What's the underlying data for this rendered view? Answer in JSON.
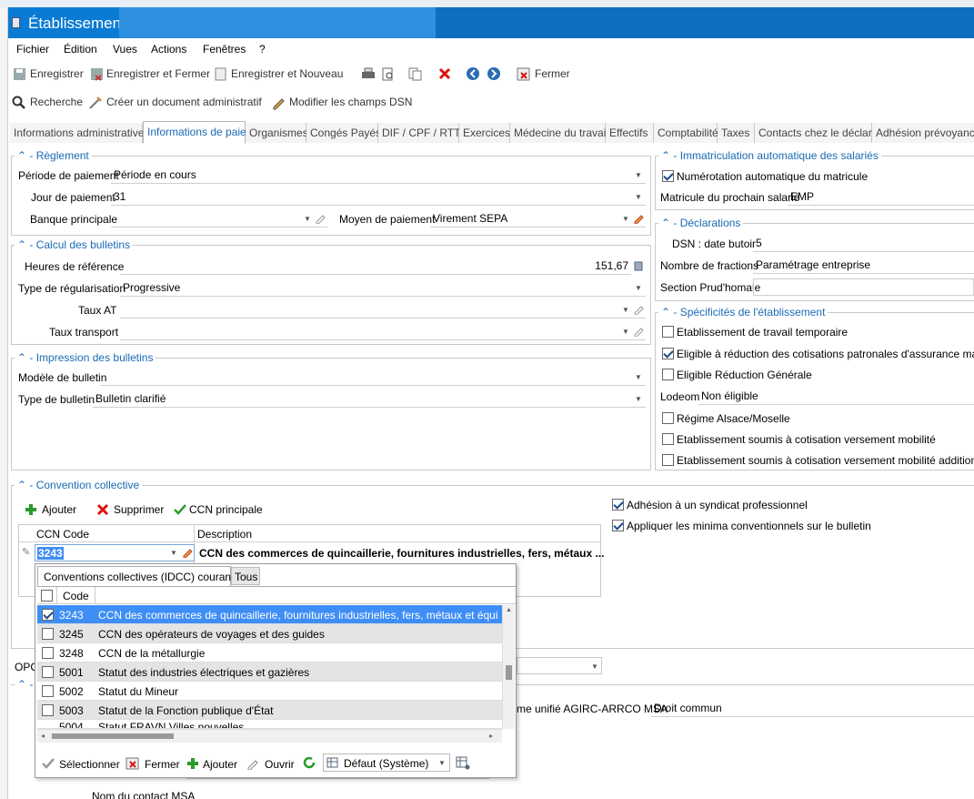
{
  "window": {
    "title": "Établissement"
  },
  "menu": [
    "Fichier",
    "Édition",
    "Vues",
    "Actions",
    "Fenêtres",
    "?"
  ],
  "toolbar": {
    "save": "Enregistrer",
    "save_close": "Enregistrer et Fermer",
    "save_new": "Enregistrer et Nouveau",
    "close": "Fermer"
  },
  "toolbar2": {
    "search": "Recherche",
    "create_doc": "Créer un document administratif",
    "edit_dsn": "Modifier les champs DSN"
  },
  "tabs": [
    "Informations administratives",
    "Informations de paie",
    "Organismes",
    "Congés Payés",
    "DIF / CPF / RTT",
    "Exercices",
    "Médecine du travail",
    "Effectifs",
    "Comptabilité",
    "Taxes",
    "Contacts chez le déclaré",
    "Adhésion prévoyance"
  ],
  "reglement": {
    "title": "Règlement",
    "periode_label": "Période de paiement",
    "periode_value": "Période en cours",
    "jour_label": "Jour de paiement",
    "jour_value": "31",
    "banque_label": "Banque principale",
    "banque_value": "",
    "moyen_label": "Moyen de paiement",
    "moyen_value": "Virement SEPA"
  },
  "calcul": {
    "title": "Calcul des bulletins",
    "heures_label": "Heures de référence",
    "heures_value": "151,67",
    "regul_label": "Type de régularisation",
    "regul_value": "Progressive",
    "taux_at_label": "Taux AT",
    "taux_transport_label": "Taux transport"
  },
  "impression": {
    "title": "Impression des bulletins",
    "modele_label": "Modèle de bulletin",
    "modele_value": "",
    "type_label": "Type de bulletin",
    "type_value": "Bulletin clarifié"
  },
  "immatriculation": {
    "title": "Immatriculation automatique des salariés",
    "auto_label": "Numérotation automatique du matricule",
    "auto_checked": true,
    "next_label": "Matricule du prochain salarié",
    "next_value": "EMP"
  },
  "declarations": {
    "title": "Déclarations",
    "dsn_label": "DSN : date butoir",
    "dsn_value": "5",
    "fractions_label": "Nombre de fractions",
    "fractions_value": "Paramétrage entreprise",
    "section_label": "Section Prud'homale",
    "section_value": ""
  },
  "specificites": {
    "title": "Spécificités de l'établissement",
    "items": [
      {
        "label": "Etablissement de travail temporaire",
        "checked": false
      },
      {
        "label": "Eligible à réduction des cotisations patronales d'assurance maladie",
        "checked": true
      },
      {
        "label": "Eligible Réduction Générale",
        "checked": false
      }
    ],
    "lodeom_label": "Lodeom",
    "lodeom_value": "Non éligible",
    "items2": [
      {
        "label": "Régime Alsace/Moselle",
        "checked": false
      },
      {
        "label": "Etablissement soumis à cotisation versement mobilité",
        "checked": false
      },
      {
        "label": "Etablissement soumis à cotisation versement mobilité additionnel",
        "checked": false
      }
    ]
  },
  "convention": {
    "title": "Convention collective",
    "add": "Ajouter",
    "delete": "Supprimer",
    "main": "CCN principale",
    "col_code": "CCN Code",
    "col_desc": "Description",
    "code_value": "3243",
    "desc_value": "CCN des commerces de quincaillerie, fournitures industrielles, fers, métaux ...",
    "adhesion_label": "Adhésion à un syndicat professionnel",
    "minima_label": "Appliquer les minima conventionnels sur le bulletin"
  },
  "popup": {
    "tab1": "Conventions collectives (IDCC) courantes",
    "tab2": "Tous",
    "col_code": "Code",
    "rows": [
      {
        "code": "3243",
        "desc": "CCN des commerces de quincaillerie, fournitures industrielles, fers, métaux et équipement de",
        "checked": true
      },
      {
        "code": "3245",
        "desc": "CCN des opérateurs de voyages et des guides",
        "checked": false
      },
      {
        "code": "3248",
        "desc": "CCN de la métallurgie",
        "checked": false
      },
      {
        "code": "5001",
        "desc": "Statut des industries électriques et gazières",
        "checked": false
      },
      {
        "code": "5002",
        "desc": "Statut du Mineur",
        "checked": false
      },
      {
        "code": "5003",
        "desc": "Statut de la Fonction publique d'État",
        "checked": false
      },
      {
        "code": "5004",
        "desc": "Statut FRAVN Villes nouvelles",
        "checked": false
      }
    ],
    "select": "Sélectionner",
    "close": "Fermer",
    "add": "Ajouter",
    "open": "Ouvrir",
    "view": "Défaut (Système)"
  },
  "bottom": {
    "opc_label": "OPC",
    "regime_label": "me unifié AGIRC-ARRCO MSA",
    "regime_value": "Droit commun",
    "contact_label": "Nom du contact MSA"
  },
  "colors": {
    "accent": "#1a6ab5",
    "titlebar": "#0a7bd4",
    "selection": "#3f8ef5"
  }
}
